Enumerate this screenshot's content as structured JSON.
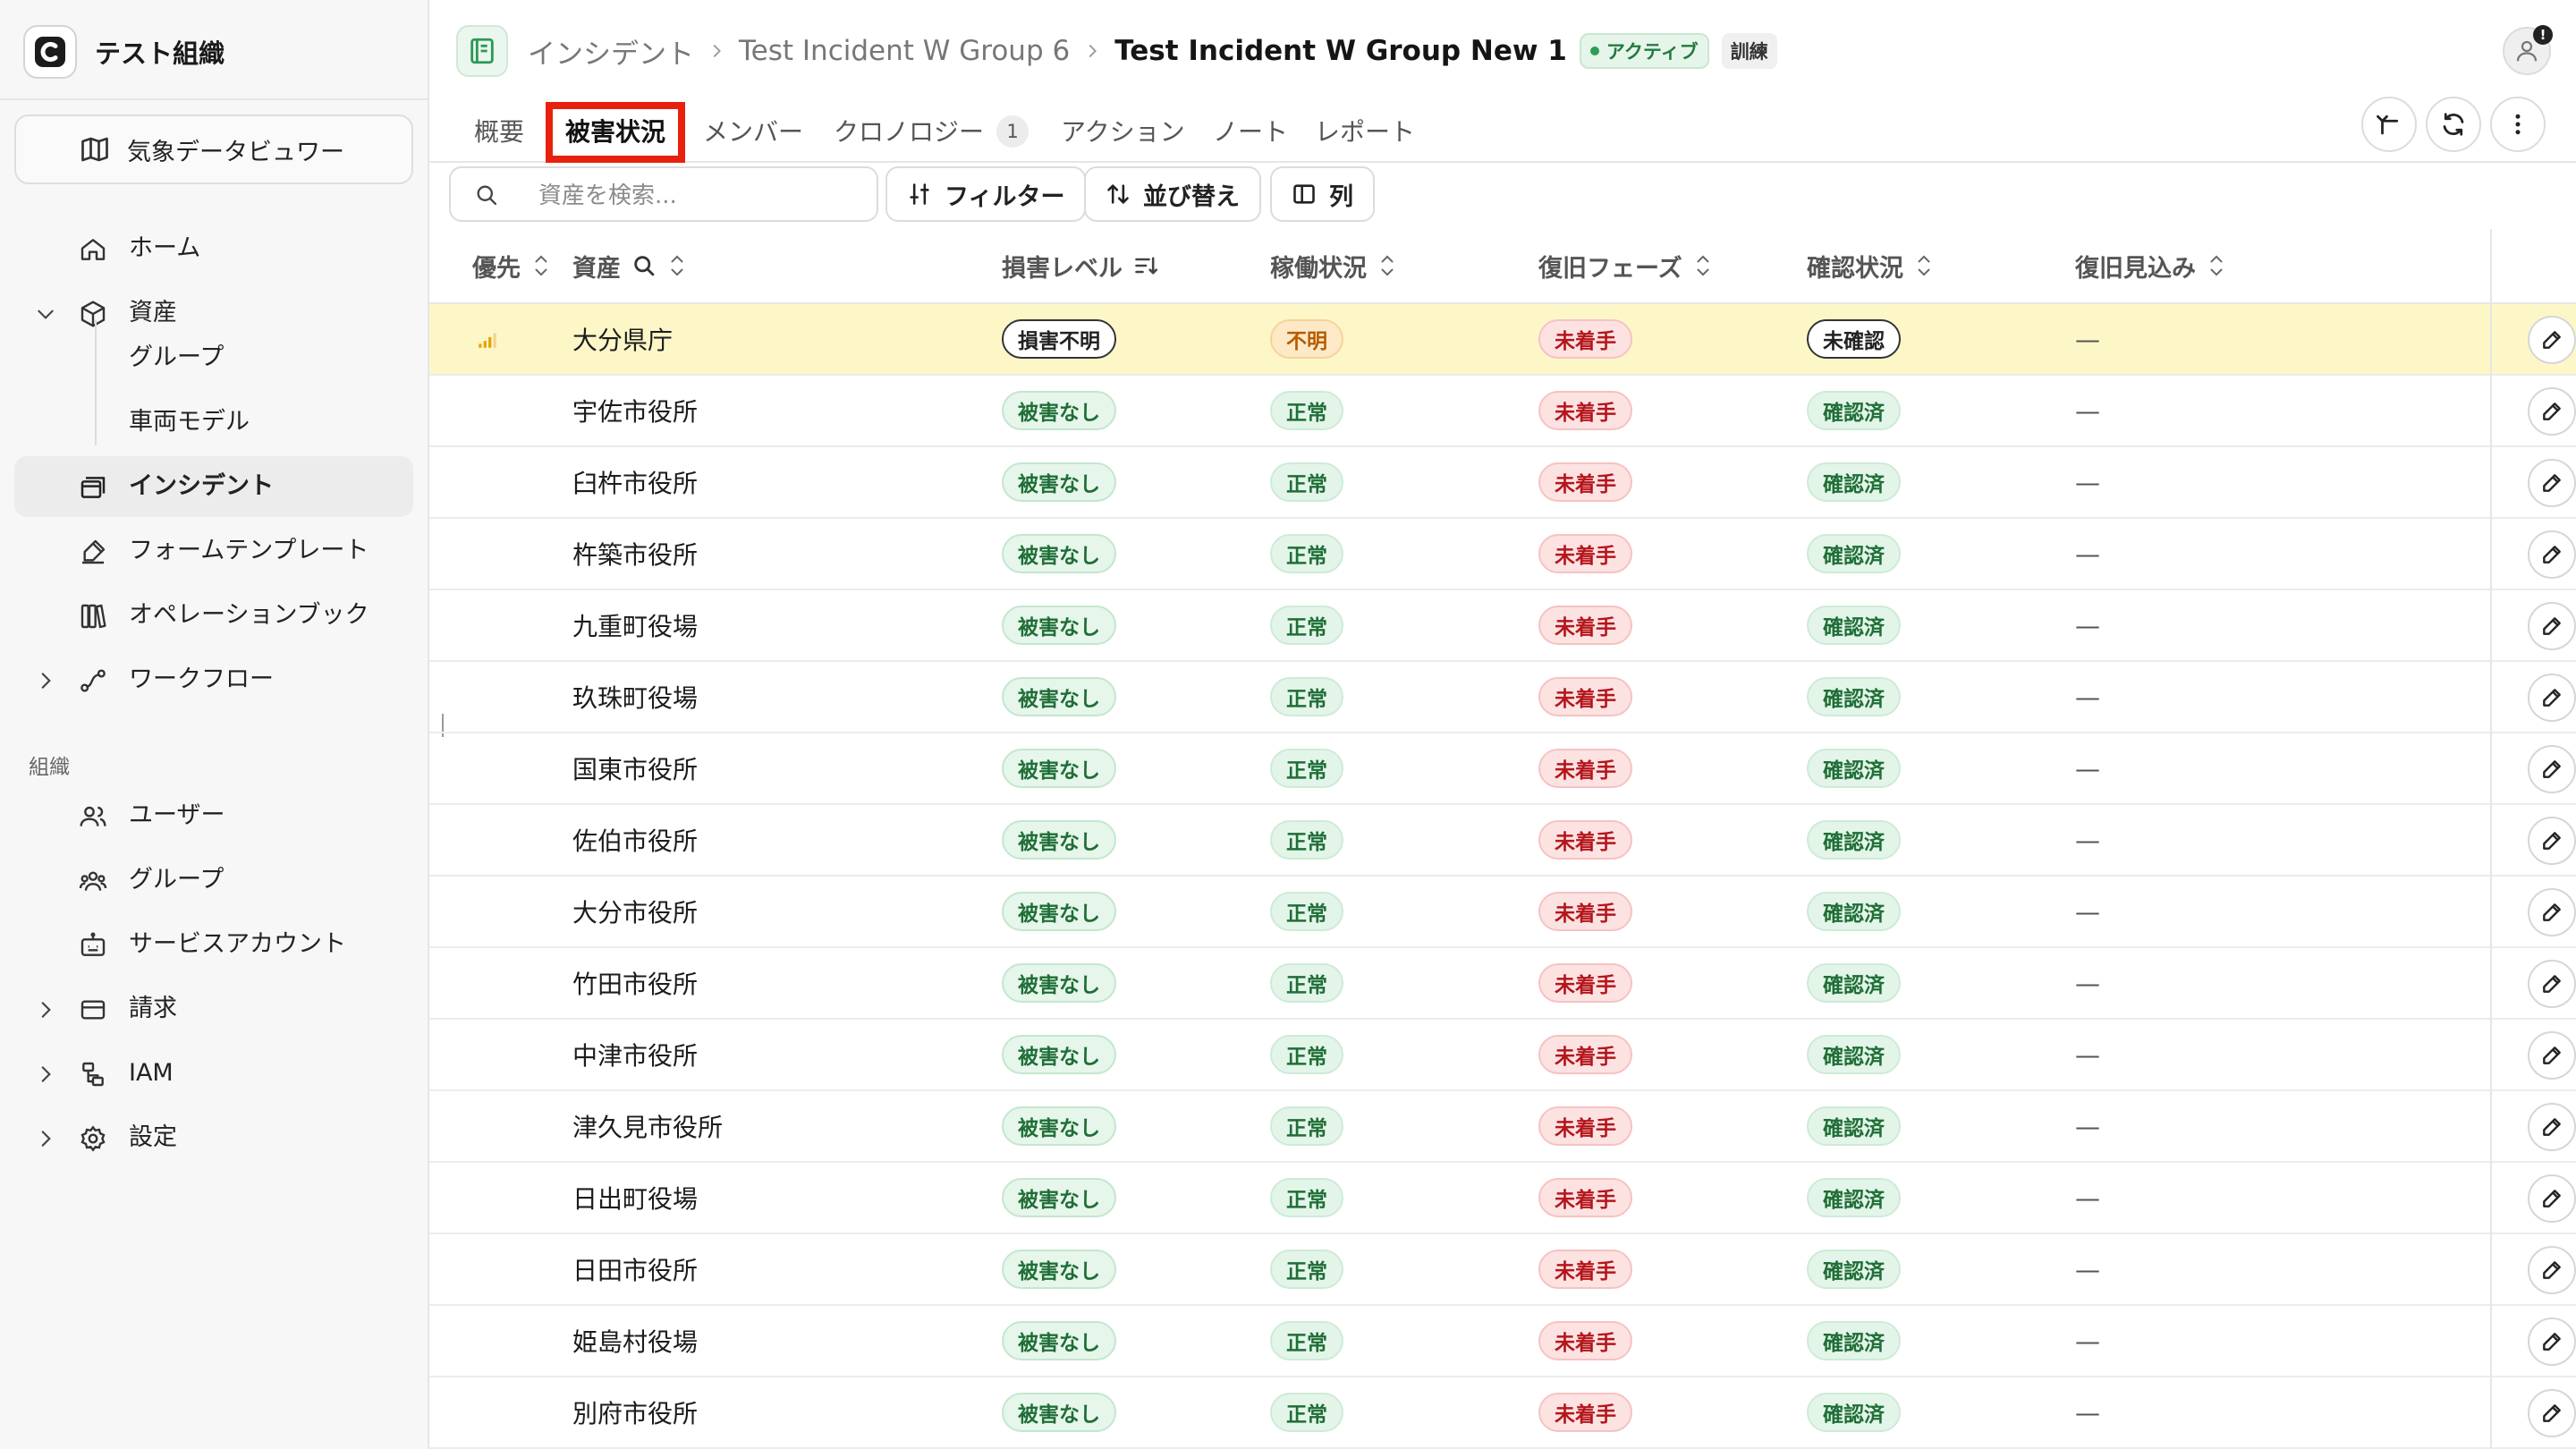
{
  "org": {
    "name": "テスト組織"
  },
  "sidebar": {
    "weather_viewer": "気象データビュワー",
    "items": [
      {
        "label": "ホーム",
        "icon": "home-icon"
      },
      {
        "label": "資産",
        "icon": "package-icon",
        "expanded": true
      },
      {
        "label": "グループ",
        "sub": true
      },
      {
        "label": "車両モデル",
        "sub": true
      },
      {
        "label": "インシデント",
        "icon": "incident-icon",
        "active": true
      },
      {
        "label": "フォームテンプレート",
        "icon": "form-template-icon"
      },
      {
        "label": "オペレーションブック",
        "icon": "book-icon"
      },
      {
        "label": "ワークフロー",
        "icon": "workflow-icon",
        "collapsed": true
      }
    ],
    "section_org": "組織",
    "org_items": [
      {
        "label": "ユーザー",
        "icon": "users-icon"
      },
      {
        "label": "グループ",
        "icon": "group-icon"
      },
      {
        "label": "サービスアカウント",
        "icon": "service-account-icon"
      },
      {
        "label": "請求",
        "icon": "billing-icon",
        "collapsed": true
      },
      {
        "label": "IAM",
        "icon": "iam-icon",
        "collapsed": true
      },
      {
        "label": "設定",
        "icon": "settings-icon",
        "collapsed": true
      }
    ]
  },
  "header": {
    "breadcrumb": [
      "インシデント",
      "Test Incident W Group 6",
      "Test Incident W Group New 1"
    ],
    "status_badge": "アクティブ",
    "drill_badge": "訓練",
    "notification_count": "!"
  },
  "tabs": [
    {
      "label": "概要"
    },
    {
      "label": "被害状況",
      "selected": true
    },
    {
      "label": "メンバー"
    },
    {
      "label": "クロノロジー",
      "count": "1"
    },
    {
      "label": "アクション"
    },
    {
      "label": "ノート"
    },
    {
      "label": "レポート"
    }
  ],
  "toolbar": {
    "search_placeholder": "資産を検索...",
    "filter": "フィルター",
    "sort": "並び替え",
    "columns": "列"
  },
  "table": {
    "columns": [
      "優先",
      "資産",
      "損害レベル",
      "稼働状況",
      "復旧フェーズ",
      "確認状況",
      "復旧見込み"
    ],
    "rows": [
      {
        "name": "大分県庁",
        "damage": "損害不明",
        "operation": "不明",
        "phase": "未着手",
        "confirm": "未確認",
        "eta": "—",
        "priority": true,
        "highlight": true
      },
      {
        "name": "宇佐市役所",
        "damage": "被害なし",
        "operation": "正常",
        "phase": "未着手",
        "confirm": "確認済",
        "eta": "—"
      },
      {
        "name": "臼杵市役所",
        "damage": "被害なし",
        "operation": "正常",
        "phase": "未着手",
        "confirm": "確認済",
        "eta": "—"
      },
      {
        "name": "杵築市役所",
        "damage": "被害なし",
        "operation": "正常",
        "phase": "未着手",
        "confirm": "確認済",
        "eta": "—"
      },
      {
        "name": "九重町役場",
        "damage": "被害なし",
        "operation": "正常",
        "phase": "未着手",
        "confirm": "確認済",
        "eta": "—"
      },
      {
        "name": "玖珠町役場",
        "damage": "被害なし",
        "operation": "正常",
        "phase": "未着手",
        "confirm": "確認済",
        "eta": "—"
      },
      {
        "name": "国東市役所",
        "damage": "被害なし",
        "operation": "正常",
        "phase": "未着手",
        "confirm": "確認済",
        "eta": "—"
      },
      {
        "name": "佐伯市役所",
        "damage": "被害なし",
        "operation": "正常",
        "phase": "未着手",
        "confirm": "確認済",
        "eta": "—"
      },
      {
        "name": "大分市役所",
        "damage": "被害なし",
        "operation": "正常",
        "phase": "未着手",
        "confirm": "確認済",
        "eta": "—"
      },
      {
        "name": "竹田市役所",
        "damage": "被害なし",
        "operation": "正常",
        "phase": "未着手",
        "confirm": "確認済",
        "eta": "—"
      },
      {
        "name": "中津市役所",
        "damage": "被害なし",
        "operation": "正常",
        "phase": "未着手",
        "confirm": "確認済",
        "eta": "—"
      },
      {
        "name": "津久見市役所",
        "damage": "被害なし",
        "operation": "正常",
        "phase": "未着手",
        "confirm": "確認済",
        "eta": "—"
      },
      {
        "name": "日出町役場",
        "damage": "被害なし",
        "operation": "正常",
        "phase": "未着手",
        "confirm": "確認済",
        "eta": "—"
      },
      {
        "name": "日田市役所",
        "damage": "被害なし",
        "operation": "正常",
        "phase": "未着手",
        "confirm": "確認済",
        "eta": "—"
      },
      {
        "name": "姫島村役場",
        "damage": "被害なし",
        "operation": "正常",
        "phase": "未着手",
        "confirm": "確認済",
        "eta": "—"
      },
      {
        "name": "別府市役所",
        "damage": "被害なし",
        "operation": "正常",
        "phase": "未着手",
        "confirm": "確認済",
        "eta": "—"
      }
    ]
  },
  "colors": {
    "selected_tab_outline": "#e8210e",
    "highlight_row": "#fdf7c8",
    "green_badge": "#e6f6ea",
    "red_badge": "#fde2e2",
    "orange_badge": "#fde9c6"
  }
}
